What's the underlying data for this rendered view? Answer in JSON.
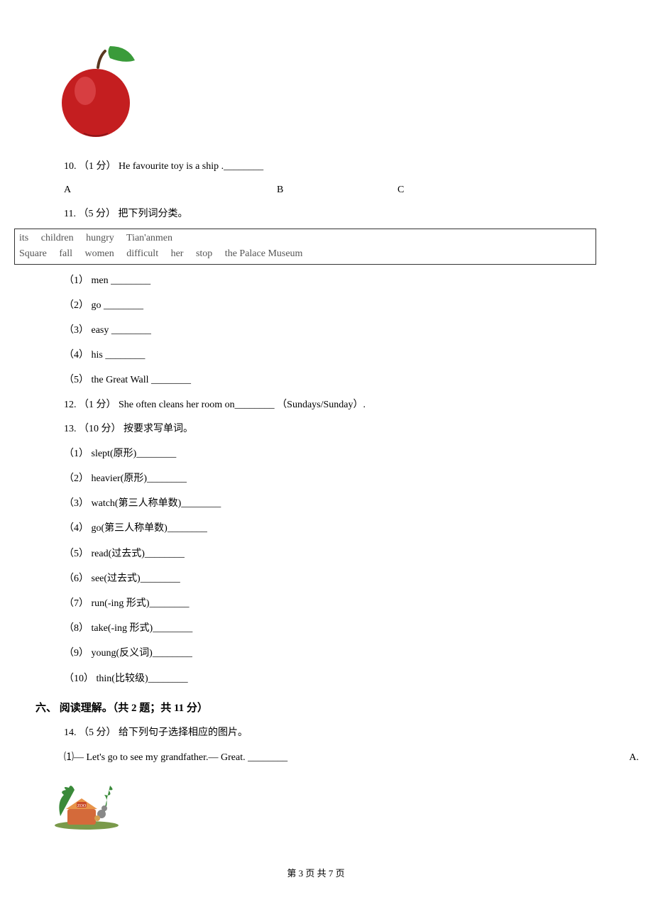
{
  "q10": {
    "num": "10.",
    "points": "（1 分）",
    "text": "He favourite toy is a ship .________",
    "optA": "A",
    "optB": "B",
    "optC": "C"
  },
  "q11": {
    "num": "11.",
    "points": "（5 分）",
    "text": "把下列词分类。",
    "box_line1": "its     children     hungry     Tian'anmen",
    "box_line2": "Square     fall     women     difficult     her     stop     the Palace Museum",
    "items": {
      "1": "（1） men ________",
      "2": "（2） go ________",
      "3": "（3） easy ________",
      "4": "（4） his ________",
      "5": "（5） the Great Wall ________"
    }
  },
  "q12": {
    "num": "12.",
    "points": "（1 分）",
    "text": "She often cleans her room on________ （Sundays/Sunday）."
  },
  "q13": {
    "num": "13.",
    "points": "（10 分）",
    "text": "按要求写单词。",
    "items": {
      "1": "（1） slept(原形)________",
      "2": "（2） heavier(原形)________",
      "3": "（3） watch(第三人称单数)________",
      "4": "（4） go(第三人称单数)________",
      "5": "（5） read(过去式)________",
      "6": "（6） see(过去式)________",
      "7": "（7） run(-ing 形式)________",
      "8": "（8） take(-ing 形式)________",
      "9": "（9） young(反义词)________",
      "10": "（10） thin(比较级)________"
    }
  },
  "section6": {
    "title": "六、 阅读理解。（共 2 题；共 11 分）"
  },
  "q14": {
    "num": "14.",
    "points": "（5 分）",
    "text": "给下列句子选择相应的图片。",
    "item1_left": "⑴— Let's go to see my grandfather.— Great. ________",
    "item1_right": "A."
  },
  "footer": "第 3 页 共 7 页"
}
